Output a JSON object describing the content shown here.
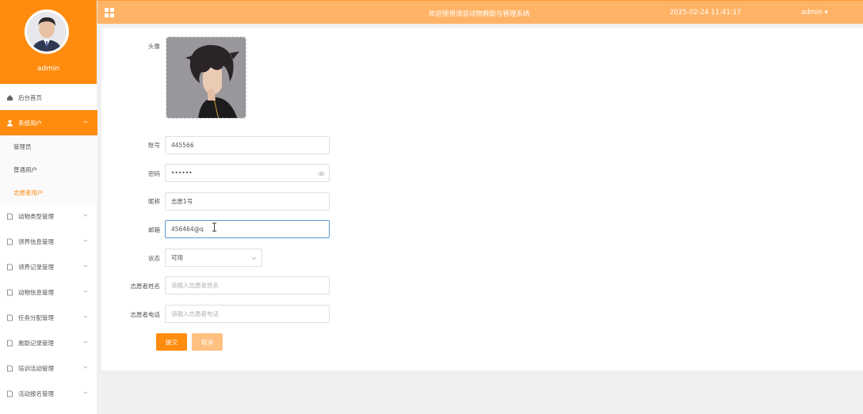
{
  "sidebar": {
    "username": "admin",
    "items": [
      {
        "label": "后台首页"
      },
      {
        "label": "系统用户"
      },
      {
        "label": "动物类型管理"
      },
      {
        "label": "领养信息管理"
      },
      {
        "label": "领养记录管理"
      },
      {
        "label": "动物信息管理"
      },
      {
        "label": "任务分配管理"
      },
      {
        "label": "救助记录管理"
      },
      {
        "label": "培训活动管理"
      },
      {
        "label": "活动报名管理"
      }
    ],
    "subitems": [
      {
        "label": "管理员"
      },
      {
        "label": "普通用户"
      },
      {
        "label": "志愿者用户"
      }
    ]
  },
  "topbar": {
    "title": "欢迎使用流浪动物救助与管理系统",
    "datetime": "2025-02-24 11:41:17",
    "user": "admin ▾"
  },
  "form": {
    "avatar_label": "头像",
    "account_label": "账号",
    "account_value": "445566",
    "password_label": "密码",
    "password_value": "••••••",
    "nickname_label": "昵称",
    "nickname_value": "志愿1号",
    "email_label": "邮箱",
    "email_value": "456464@q",
    "status_label": "状态",
    "status_value": "可用",
    "volunteer_name_label": "志愿者姓名",
    "volunteer_name_placeholder": "请输入志愿者姓名",
    "volunteer_phone_label": "志愿者电话",
    "volunteer_phone_placeholder": "请输入志愿者电话",
    "submit_label": "提交",
    "cancel_label": "取消"
  },
  "colors": {
    "accent": "#ff8c0f",
    "topbar": "#ffb366"
  }
}
